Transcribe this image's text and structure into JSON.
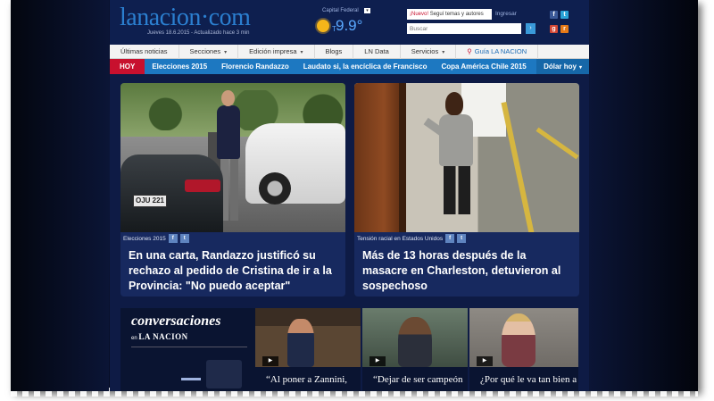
{
  "header": {
    "logo_text": "lanacion·com",
    "date_text": "Jueves 18.6.2015 - Actualizado hace 3 min",
    "weather_city": "Capital Federal",
    "temperature": "9.9°",
    "temperature_prefix": "T",
    "nuevo_badge": "¡Nuevo!",
    "nuevo_text": "Seguí temas y autores",
    "login_link": "Ingresar",
    "search_placeholder": "Buscar",
    "search_button": "›",
    "social": {
      "facebook": "f",
      "twitter": "t",
      "googleplus": "g+",
      "rss": "rss"
    }
  },
  "nav": {
    "items": [
      {
        "label": "Últimas noticias",
        "dropdown": false
      },
      {
        "label": "Secciones",
        "dropdown": true
      },
      {
        "label": "Edición impresa",
        "dropdown": true
      },
      {
        "label": "Blogs",
        "dropdown": false
      },
      {
        "label": "LN Data",
        "dropdown": false
      },
      {
        "label": "Servicios",
        "dropdown": true
      }
    ],
    "guia_label": "Guía LA NACION",
    "caret": "▾"
  },
  "topics": {
    "today_label": "HOY",
    "items": [
      "Elecciones 2015",
      "Florencio Randazzo",
      "Laudato si, la encíclica de Francisco",
      "Copa América Chile 2015"
    ],
    "dollar_label": "Dólar hoy",
    "caret": "▾"
  },
  "hero": [
    {
      "tag": "Elecciones 2015",
      "title": "En una carta, Randazzo justificó su rechazo al pedido de Cristina de ir a la Provincia: \"No puedo aceptar\"",
      "plate": "OJU 221"
    },
    {
      "tag": "Tensión racial en Estados Unidos",
      "title": "Más de 13 horas después de la masacre en Charleston, detuvieron al sospechoso"
    }
  ],
  "conversaciones": {
    "title": "conversaciones",
    "sub_prefix": "en",
    "sub_brand": "LA NACION"
  },
  "videos": [
    {
      "caption": "“Al poner a Zannini,",
      "play": "▶"
    },
    {
      "caption": "“Dejar de ser campeón",
      "play": "▶"
    },
    {
      "caption": "¿Por qué le va tan bien a",
      "play": "▶"
    }
  ],
  "colors": {
    "brand_blue": "#2b7fd0",
    "topics_bar": "#1d78c1",
    "hoy_red": "#c8102e",
    "page_bg": "#0e1b45"
  }
}
